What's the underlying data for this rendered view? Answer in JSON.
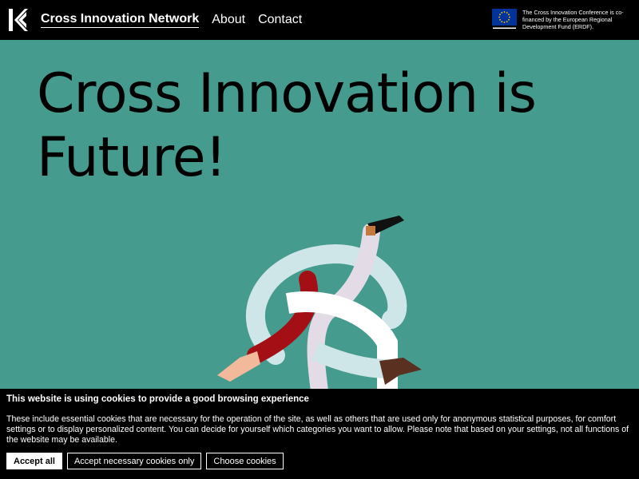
{
  "header": {
    "logo_icon": "k-logo-icon",
    "nav": {
      "brand": "Cross Innovation Network",
      "about": "About",
      "contact": "Contact"
    },
    "eu_flag_icon": "eu-flag-icon",
    "funding_notice": "The Cross Innovation Conference is co-financed by the European Regional Development Fund (ERDF)."
  },
  "hero": {
    "title_line1": "Cross Innovation is",
    "title_line2": "Future!",
    "background_color": "#459b8d",
    "illustration": "intertwined-arms-illustration"
  },
  "cookie_banner": {
    "title": "This website is using cookies to provide a good browsing experience",
    "text": "These include essential cookies that are necessary for the operation of the site, as well as others that are used only for anonymous statistical purposes, for comfort settings or to display personalized content. You can decide for yourself which categories you want to allow. Please note that based on your settings, not all functions of the website may be available.",
    "buttons": {
      "accept_all": "Accept all",
      "accept_necessary": "Accept necessary cookies only",
      "choose": "Choose cookies"
    }
  }
}
